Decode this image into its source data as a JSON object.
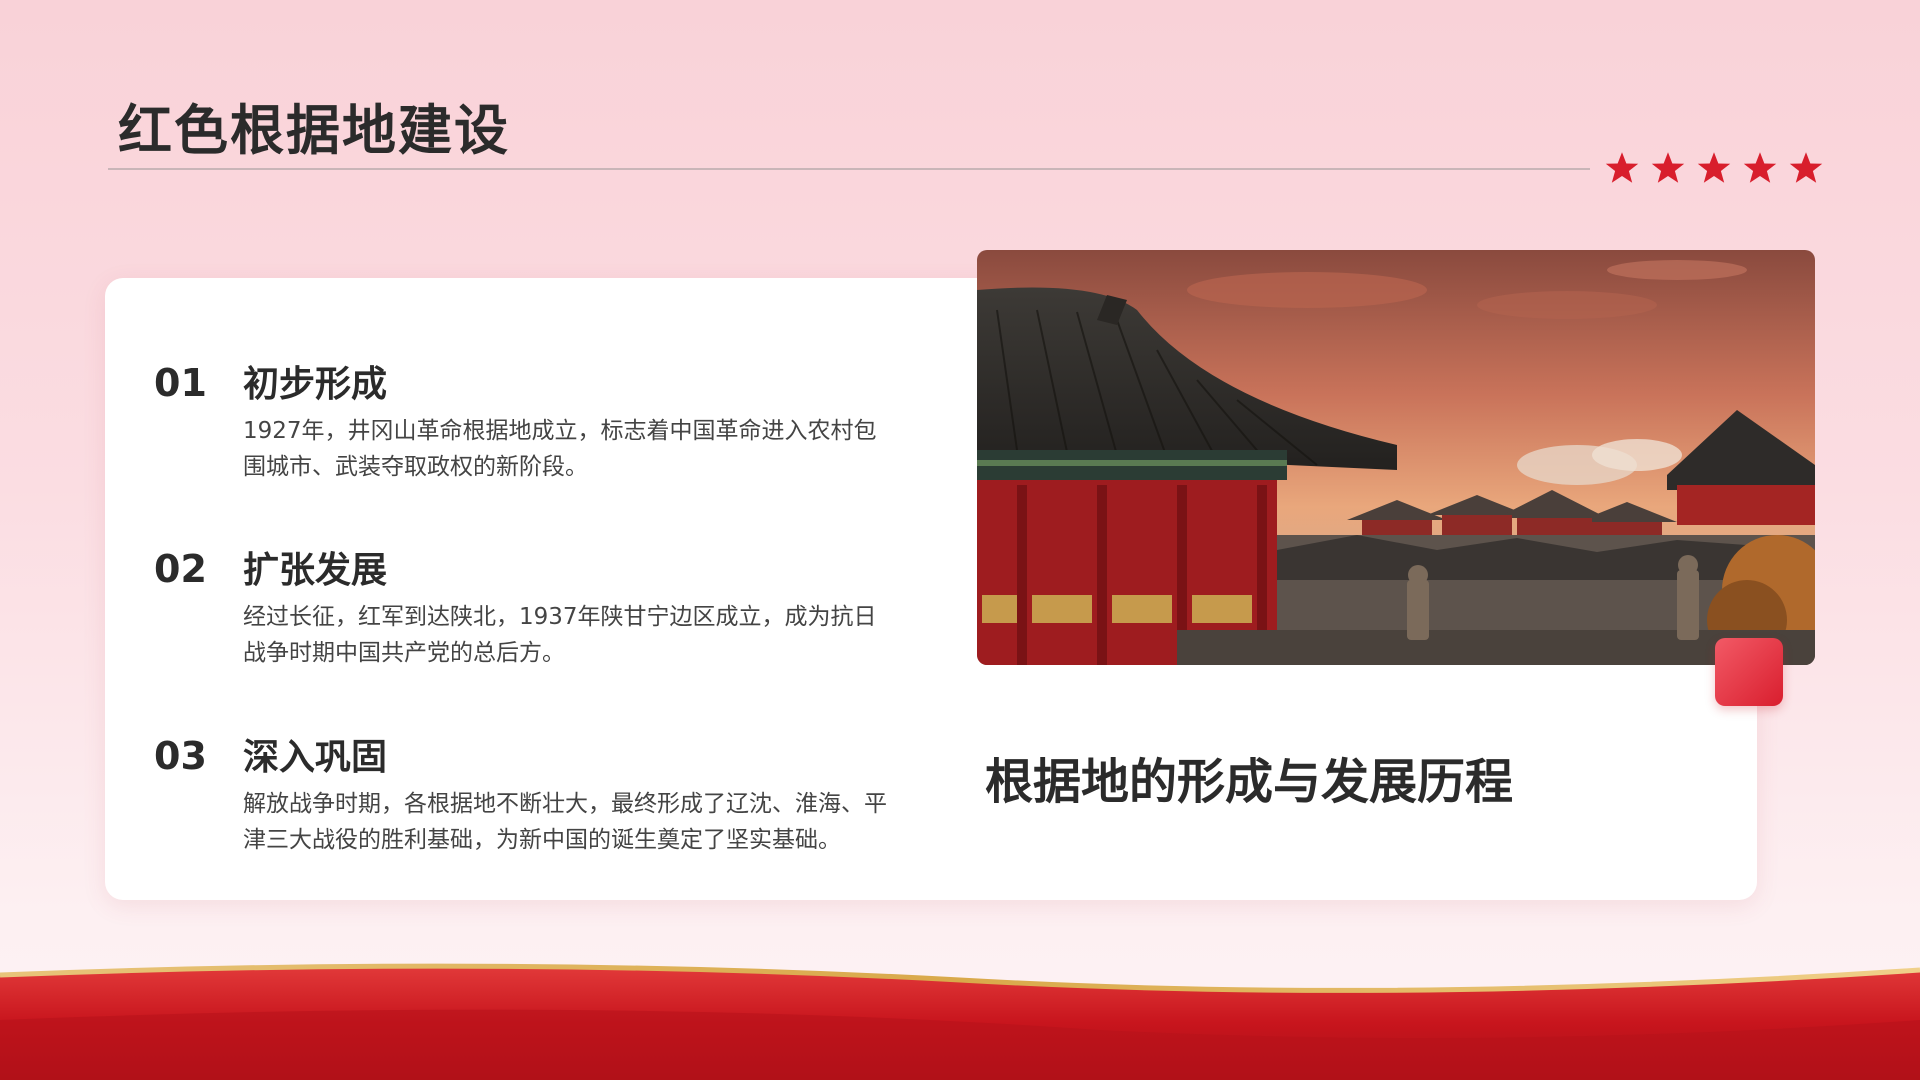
{
  "slide": {
    "title": "红色根据地建设",
    "subtitle": "根据地的形成与发展历程",
    "star_count": 5,
    "colors": {
      "accent": "#d81e2c",
      "star": "#d81e2c",
      "background_top": "#f9d2d8",
      "card": "#ffffff",
      "ribbon": "#c8151d",
      "ribbon_trim": "#d9a94a"
    }
  },
  "items": [
    {
      "number": "01",
      "title": "初步形成",
      "description": "1927年，井冈山革命根据地成立，标志着中国革命进入农村包围城市、武装夺取政权的新阶段。"
    },
    {
      "number": "02",
      "title": "扩张发展",
      "description": "经过长征，红军到达陕北，1937年陕甘宁边区成立，成为抗日战争时期中国共产党的总后方。"
    },
    {
      "number": "03",
      "title": "深入巩固",
      "description": "解放战争时期，各根据地不断壮大，最终形成了辽沈、淮海、平津三大战役的胜利基础，为新中国的诞生奠定了坚实基础。"
    }
  ],
  "image": {
    "icon": "traditional-chinese-architecture-sunset-photo"
  }
}
